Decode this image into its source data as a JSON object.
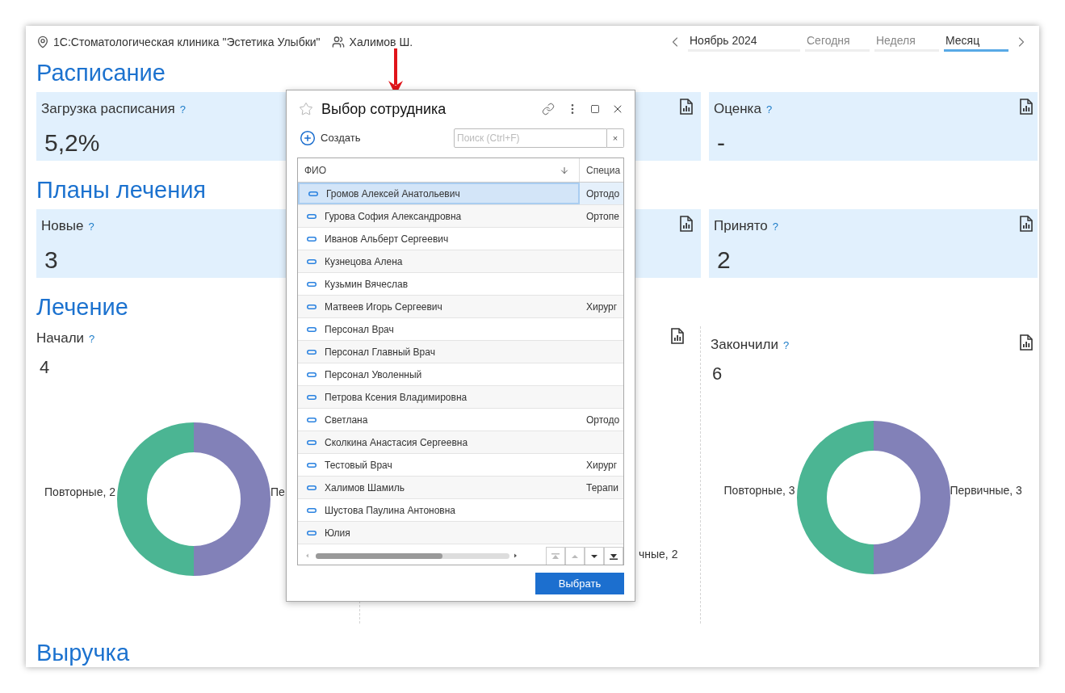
{
  "header": {
    "organization": "1С:Стоматологическая клиника \"Эстетика Улыбки\"",
    "user": "Халимов Ш.",
    "period": "Ноябрь 2024",
    "view_tabs": [
      {
        "label": "Сегодня",
        "selected": false
      },
      {
        "label": "Неделя",
        "selected": false
      },
      {
        "label": "Месяц",
        "selected": true
      }
    ]
  },
  "sections": [
    {
      "title": "Расписание",
      "kind": "cards",
      "panels": [
        {
          "kind": "metric",
          "title": "Загрузка расписания",
          "help": "?",
          "value": "5,2%"
        },
        {
          "kind": "covered"
        },
        {
          "kind": "metric",
          "title": "Оценка",
          "help": "?",
          "value": "-"
        }
      ]
    },
    {
      "title": "Планы лечения",
      "kind": "cards",
      "panels": [
        {
          "kind": "metric",
          "title": "Новые",
          "help": "?",
          "value": "3"
        },
        {
          "kind": "covered"
        },
        {
          "kind": "metric",
          "title": "Принято",
          "help": "?",
          "value": "2"
        }
      ]
    },
    {
      "title": "Лечение",
      "kind": "charts",
      "panels": [
        {
          "kind": "chart",
          "title": "Начали",
          "help": "?",
          "value": "4",
          "chart_data": {
            "type": "donut",
            "categories": [
              "Повторные, 2",
              "Пе"
            ],
            "values": [
              2,
              2
            ],
            "colors": [
              "#4bb593",
              "#8281b8"
            ]
          }
        },
        {
          "kind": "covered",
          "label": "чные, 2"
        },
        {
          "kind": "chart",
          "title": "Закончили",
          "help": "?",
          "value": "6",
          "chart_data": {
            "type": "donut",
            "categories": [
              "Повторные, 3",
              "Первичные, 3"
            ],
            "values": [
              3,
              3
            ],
            "colors": [
              "#4bb593",
              "#8281b8"
            ]
          }
        }
      ]
    },
    {
      "title": "Выручка",
      "kind": "heading"
    }
  ],
  "dialog": {
    "title": "Выбор сотрудника",
    "create": "Создать",
    "search": {
      "placeholder": "Поиск (Ctrl+F)"
    },
    "clear": "×",
    "columns": [
      "ФИО",
      "Специа"
    ],
    "rows": [
      {
        "name": "Громов Алексей Анатольевич",
        "specialty": "Ортодо",
        "selected": true
      },
      {
        "name": "Гурова София Александровна",
        "specialty": "Ортопе",
        "selected": false
      },
      {
        "name": "Иванов Альберт Сергеевич",
        "selected": false
      },
      {
        "name": "Кузнецова Алена",
        "selected": false
      },
      {
        "name": "Кузьмин Вячеслав",
        "selected": false
      },
      {
        "name": "Матвеев Игорь Сергеевич",
        "specialty": "Хирург",
        "selected": false
      },
      {
        "name": "Персонал Врач",
        "selected": false
      },
      {
        "name": "Персонал Главный Врач",
        "selected": false
      },
      {
        "name": "Персонал Уволенный",
        "selected": false
      },
      {
        "name": "Петрова Ксения Владимировна",
        "selected": false
      },
      {
        "name": "Светлана",
        "specialty": "Ортодо",
        "selected": false
      },
      {
        "name": "Сколкина Анастасия Сергеевна",
        "selected": false
      },
      {
        "name": "Тестовый Врач",
        "specialty": "Хирург",
        "selected": false
      },
      {
        "name": "Халимов Шамиль",
        "specialty": "Терапи",
        "selected": false
      },
      {
        "name": "Шустова Паулина Антоновна",
        "selected": false
      },
      {
        "name": "Юлия",
        "selected": false
      }
    ],
    "submit": "Выбрать"
  }
}
